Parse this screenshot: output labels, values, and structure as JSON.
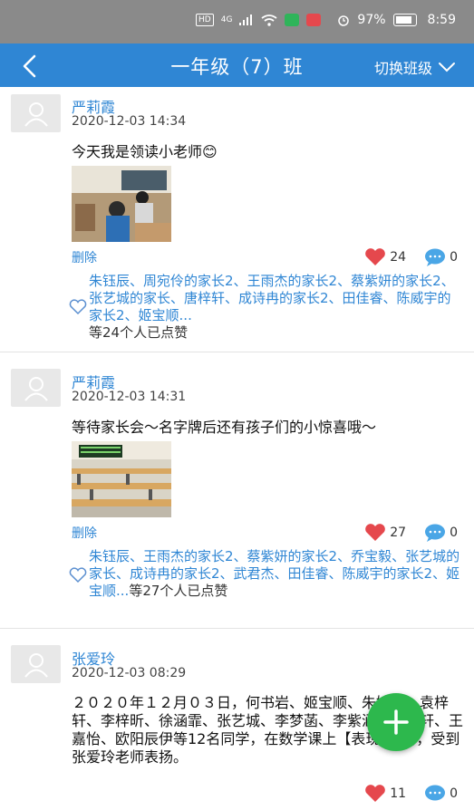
{
  "status_bar": {
    "hd": "HD",
    "net": "4G",
    "battery_pct": "97%",
    "time": "8:59"
  },
  "header": {
    "title": "一年级（7）班",
    "switch_label": "切换班级"
  },
  "posts": [
    {
      "author": "严莉霞",
      "time": "2020-12-03 14:34",
      "text": "今天我是领读小老师😊",
      "delete_label": "删除",
      "like_count": "24",
      "comment_count": "0",
      "likers": "朱钰辰、周宛伶的家长2、王雨杰的家长2、蔡紫妍的家长2、张艺城的家长、唐梓轩、成诗冉的家长2、田佳睿、陈威宇的家长2、姬宝顺...",
      "likers_suffix": "等24个人已点赞"
    },
    {
      "author": "严莉霞",
      "time": "2020-12-03 14:31",
      "text": "等待家长会～名字牌后还有孩子们的小惊喜哦～",
      "delete_label": "删除",
      "like_count": "27",
      "comment_count": "0",
      "likers": "朱钰辰、王雨杰的家长2、蔡紫妍的家长2、乔宝毅、张艺城的家长、成诗冉的家长2、武君杰、田佳睿、陈威宇的家长2、姬宝顺...",
      "likers_suffix": "等27个人已点赞"
    },
    {
      "author": "张爱玲",
      "time": "2020-12-03 08:29",
      "text": "２０２０年１２月０３日，何书岩、姬宝顺、朱婉瑜、袁梓轩、李梓昕、徐涵霏、张艺城、李梦菡、李紫涵、唐梓轩、王嘉怡、欧阳辰伊等12名同学，在数学课上【表现突出】，受到张爱玲老师表扬。",
      "like_count": "11",
      "comment_count": "0"
    }
  ],
  "colors": {
    "accent": "#2f86d4",
    "like": "#e5484d",
    "comment": "#4aa6e6",
    "fab": "#2db84d"
  }
}
